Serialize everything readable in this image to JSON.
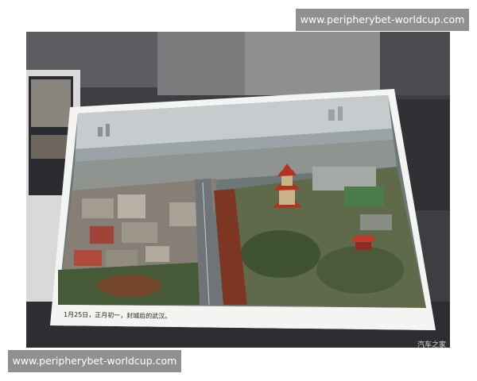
{
  "watermark": {
    "top_text": "www.peripherybet-worldcup.com",
    "bottom_text": "www.peripherybet-worldcup.com"
  },
  "photo": {
    "caption": "1月25日，正月初一，封城后的武汉。"
  },
  "corner_mark": "汽车之家",
  "colors": {
    "watermark_bg": "#787878",
    "pagoda_red": "#c0392b"
  }
}
